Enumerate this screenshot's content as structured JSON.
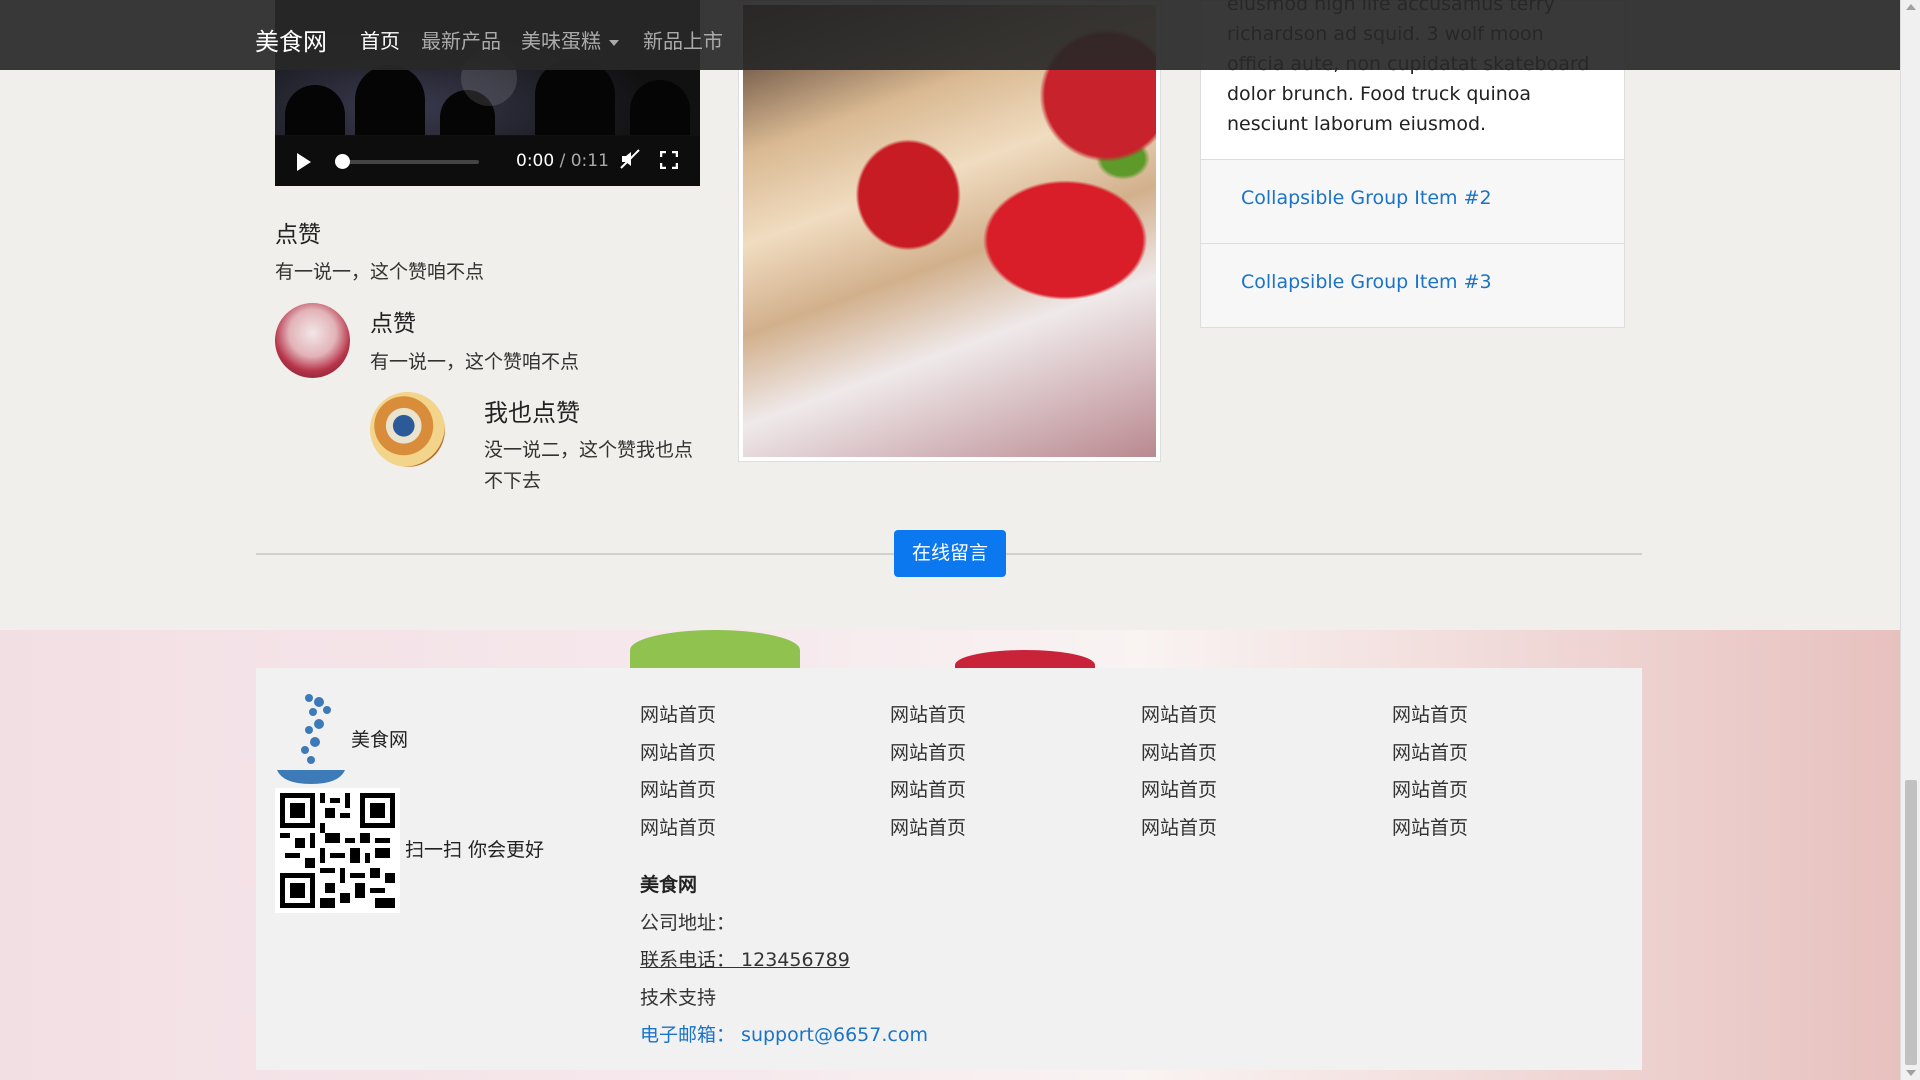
{
  "navbar": {
    "brand": "美食网",
    "items": [
      {
        "label": "首页",
        "active": true
      },
      {
        "label": "最新产品",
        "active": false
      },
      {
        "label": "美味蛋糕",
        "active": false,
        "dropdown": true
      },
      {
        "label": "新品上市",
        "active": false
      }
    ]
  },
  "video": {
    "current_time": "0:00",
    "duration": "/ 0:11",
    "progress": 0
  },
  "likes": {
    "title": "点赞",
    "text": "有一说一，这个赞咱不点",
    "comment1": {
      "title": "点赞",
      "text": "有一说一，这个赞咱不点"
    },
    "comment2": {
      "title": "我也点赞",
      "text": "没一说二，这个赞我也点不下去"
    }
  },
  "accordion": {
    "body_text": "eiusmod high life accusamus terry richardson ad squid. 3 wolf moon officia aute, non cupidatat skateboard dolor brunch. Food truck quinoa nesciunt laborum eiusmod.",
    "items": [
      "Collapsible Group Item #2",
      "Collapsible Group Item #3"
    ]
  },
  "message_button": "在线留言",
  "footer": {
    "logo_text": "美食网",
    "qr_text": "扫一扫 你会更好",
    "links": [
      [
        "网站首页",
        "网站首页",
        "网站首页",
        "网站首页"
      ],
      [
        "网站首页",
        "网站首页",
        "网站首页",
        "网站首页"
      ],
      [
        "网站首页",
        "网站首页",
        "网站首页",
        "网站首页"
      ],
      [
        "网站首页",
        "网站首页",
        "网站首页",
        "网站首页"
      ]
    ],
    "company_name": "美食网",
    "address": "公司地址：",
    "phone": "联系电话： 123456789",
    "tech": "技术支持",
    "email": "电子邮箱： support@6657.com"
  },
  "colors": {
    "accent": "#0b78f0",
    "link": "#1a73c8",
    "navbar": "#282828"
  }
}
